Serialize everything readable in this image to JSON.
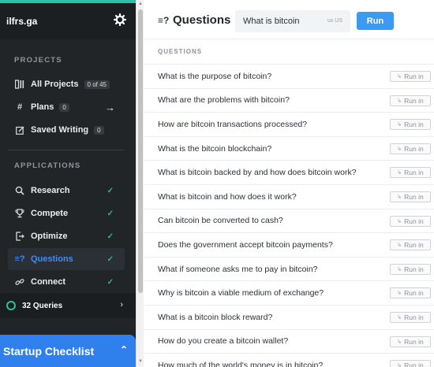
{
  "app": {
    "brand": "ilfrs.ga"
  },
  "sidebar": {
    "projects_label": "PROJECTS",
    "applications_label": "APPLICATIONS",
    "project_items": [
      {
        "label": "All Projects",
        "badge": "0 of 45",
        "icon": "projects-icon"
      },
      {
        "label": "Plans",
        "badge": "0",
        "icon": "hash-icon"
      },
      {
        "label": "Saved Writing",
        "badge": "0",
        "icon": "edit-icon"
      }
    ],
    "app_items": [
      {
        "label": "Research",
        "icon": "search-icon"
      },
      {
        "label": "Compete",
        "icon": "trophy-icon"
      },
      {
        "label": "Optimize",
        "icon": "optimize-icon"
      },
      {
        "label": "Questions",
        "icon": "questions-icon",
        "active": true
      },
      {
        "label": "Connect",
        "icon": "link-icon"
      }
    ],
    "queries": "32 Queries",
    "checklist": "Startup Checklist"
  },
  "main": {
    "title": "Questions",
    "search_value": "What is bitcoin",
    "locale": "us US",
    "run_label": "Run",
    "list_header": "QUESTIONS",
    "run_in_label": "Run in",
    "questions": [
      "What is the purpose of bitcoin?",
      "What are the problems with bitcoin?",
      "How are bitcoin transactions processed?",
      "What is the bitcoin blockchain?",
      "What is bitcoin backed by and how does bitcoin work?",
      "What is bitcoin and how does it work?",
      "Can bitcoin be converted to cash?",
      "Does the government accept bitcoin payments?",
      "What if someone asks me to pay in bitcoin?",
      "Why is bitcoin a viable medium of exchange?",
      "What is a bitcoin block reward?",
      "How do you create a bitcoin wallet?",
      "How much of the world's money is in bitcoin?"
    ]
  },
  "colors": {
    "accent": "#3c9af0",
    "sidebar_bg": "#222528",
    "check": "#2ab89a"
  }
}
